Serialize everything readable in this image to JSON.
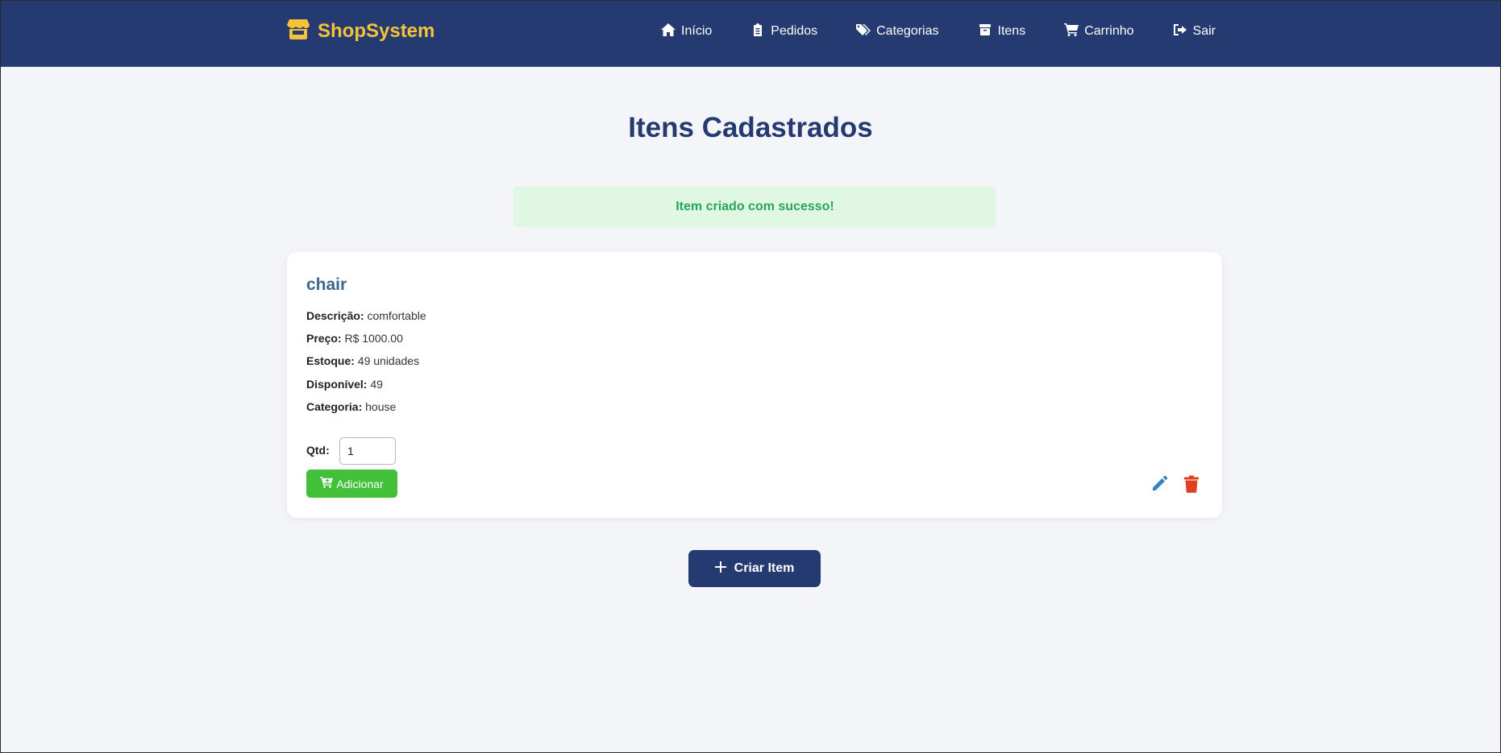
{
  "navbar": {
    "brand": "ShopSystem",
    "brand_icon": "store-icon",
    "links": [
      {
        "label": "Início",
        "icon": "home-icon"
      },
      {
        "label": "Pedidos",
        "icon": "clipboard-icon"
      },
      {
        "label": "Categorias",
        "icon": "tags-icon"
      },
      {
        "label": "Itens",
        "icon": "box-icon"
      },
      {
        "label": "Carrinho",
        "icon": "cart-icon"
      },
      {
        "label": "Sair",
        "icon": "logout-icon"
      }
    ]
  },
  "page": {
    "title": "Itens Cadastrados",
    "alert": "Item criado com sucesso!"
  },
  "item": {
    "name": "chair",
    "description_label": "Descrição:",
    "description": "comfortable",
    "price_label": "Preço:",
    "price": "R$ 1000.00",
    "stock_label": "Estoque:",
    "stock": "49 unidades",
    "available_label": "Disponível:",
    "available": "49",
    "category_label": "Categoria:",
    "category": "house",
    "qty_label": "Qtd:",
    "qty_value": "1",
    "add_button": "Adicionar"
  },
  "actions": {
    "create_button": "Criar Item"
  },
  "colors": {
    "navbar": "#253a70",
    "brand": "#f5c23a",
    "alert_bg": "#e0f7e4",
    "alert_text": "#28a55a",
    "add_button": "#43c03a",
    "edit_icon": "#2f83c6",
    "delete_icon": "#e0401f"
  }
}
